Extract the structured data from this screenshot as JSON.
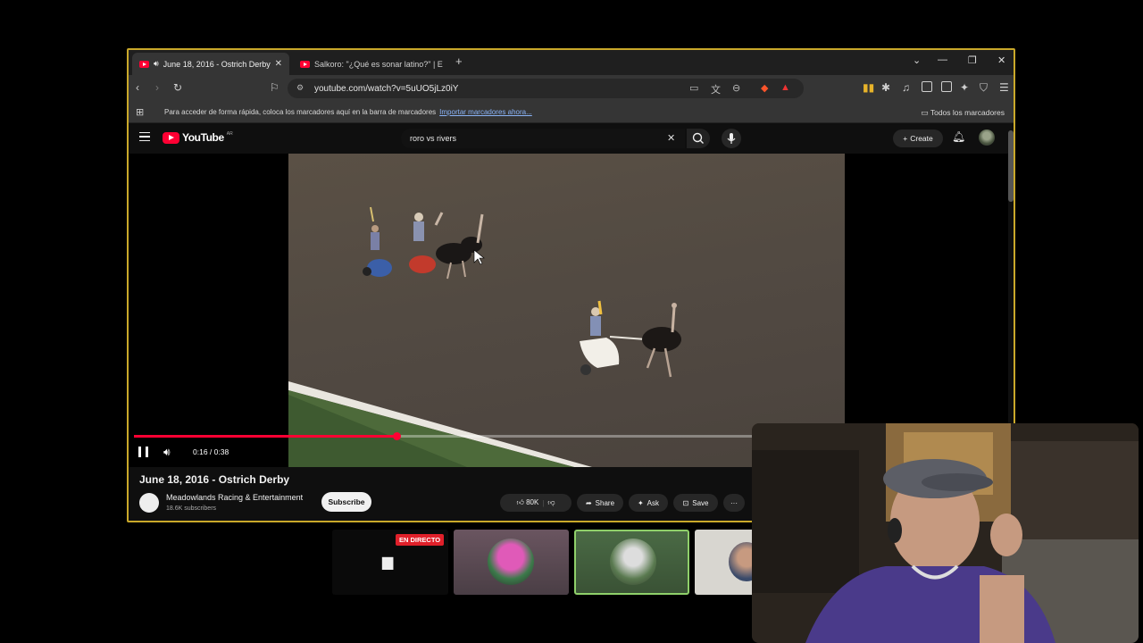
{
  "browser": {
    "tabs": [
      {
        "label": "June 18, 2016 - Ostrich Derby",
        "active": true
      },
      {
        "label": "Salkoro: \"¿Qué es sonar latino?\" | Ent",
        "active": false
      }
    ],
    "url": "youtube.com/watch?v=5uUO5jLz0iY",
    "bookmarks_hint": "Para acceder de forma rápida, coloca los marcadores aquí en la barra de marcadores",
    "bookmarks_link": "Importar marcadores ahora...",
    "all_bookmarks": "Todos los marcadores"
  },
  "youtube": {
    "logo_text": "YouTube",
    "logo_region": "AR",
    "search_query": "roro vs rivers",
    "create_label": "Create",
    "player": {
      "time": "0:16 / 0:38",
      "progress_fraction": 0.42
    },
    "video_title": "June 18, 2016 - Ostrich Derby",
    "channel_name": "Meadowlands Racing & Entertainment",
    "channel_subs": "18.6K subscribers",
    "subscribe_label": "Subscribe",
    "actions": {
      "likes": "80K",
      "share": "Share",
      "ask": "Ask",
      "save": "Save"
    }
  },
  "overlay": {
    "live_badge": "EN DIRECTO"
  },
  "colors": {
    "accent": "#c9a82a",
    "youtube_red": "#ff0033",
    "live_red": "#e0202a"
  }
}
